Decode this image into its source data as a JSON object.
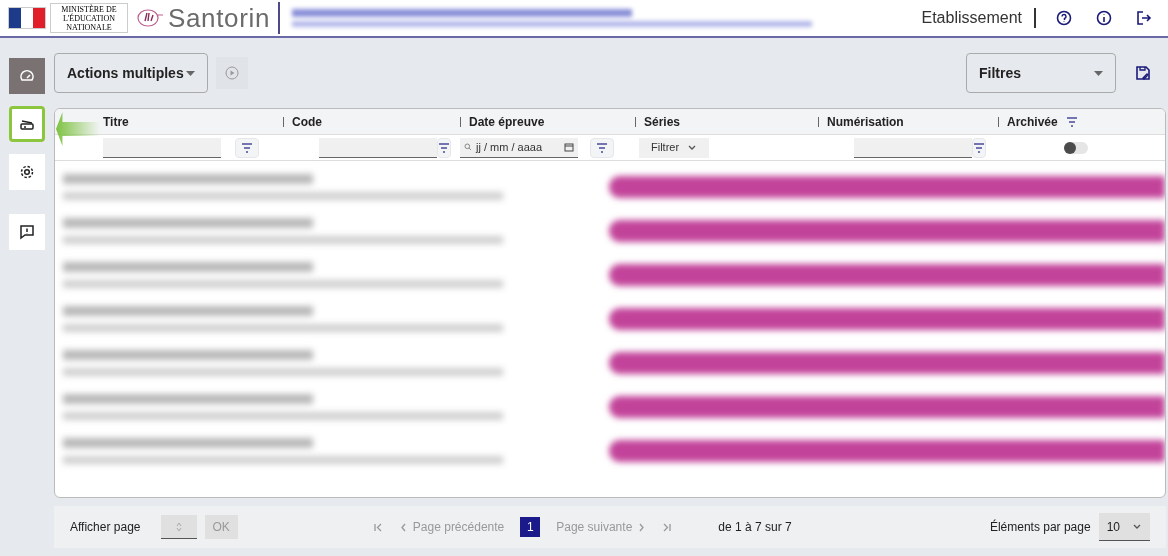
{
  "header": {
    "ministry": "MINISTÈRE DE L'ÉDUCATION NATIONALE",
    "app_name": "Santorin",
    "establishment": "Etablissement"
  },
  "sidebar": {
    "items": [
      {
        "kind": "dashboard",
        "selected": false
      },
      {
        "kind": "scanner",
        "selected": true
      },
      {
        "kind": "settings",
        "selected": false
      },
      {
        "kind": "feedback",
        "selected": false
      }
    ]
  },
  "toolbar": {
    "actions": "Actions multiples",
    "filters": "Filtres"
  },
  "table": {
    "columns": [
      {
        "label": "Titre",
        "kind": "text"
      },
      {
        "label": "Code",
        "kind": "text"
      },
      {
        "label": "Date épreuve",
        "kind": "date",
        "placeholder": "jj / mm / aaaa"
      },
      {
        "label": "Séries",
        "kind": "select",
        "value": "Filtrer"
      },
      {
        "label": "Numérisation",
        "kind": "text"
      },
      {
        "label": "Archivée",
        "kind": "toggle",
        "checked": false
      }
    ]
  },
  "pagination": {
    "show_page": "Afficher page",
    "ok": "OK",
    "previous": "Page précédente",
    "next": "Page suivante",
    "pages": [
      {
        "label": "1",
        "selected": true
      }
    ],
    "range": "de 1 à 7 sur 7",
    "per_page_label": "Éléments par page",
    "per_page": "10"
  }
}
